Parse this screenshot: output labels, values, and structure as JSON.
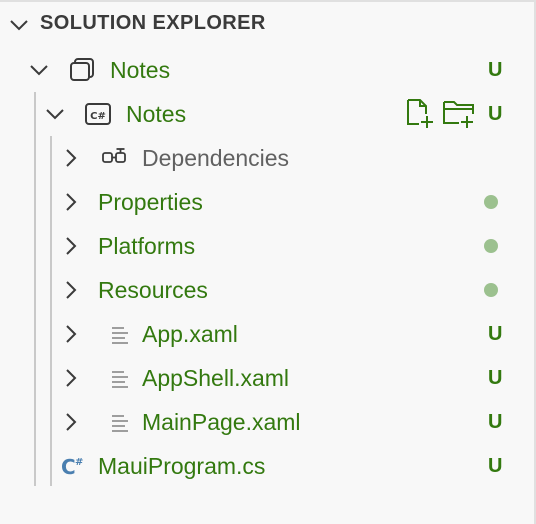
{
  "header": {
    "title": "SOLUTION EXPLORER"
  },
  "tree": {
    "solution": {
      "label": "Notes",
      "badge": "U",
      "icon": "solution-icon"
    },
    "project": {
      "label": "Notes",
      "badge": "U",
      "icon": "csharp-project-icon"
    },
    "items": [
      {
        "label": "Dependencies",
        "style": "gray",
        "icon": "dependencies-icon",
        "status": "",
        "expandable": true
      },
      {
        "label": "Properties",
        "style": "green",
        "icon": "",
        "status": "dot",
        "expandable": true
      },
      {
        "label": "Platforms",
        "style": "green",
        "icon": "",
        "status": "dot",
        "expandable": true
      },
      {
        "label": "Resources",
        "style": "green",
        "icon": "",
        "status": "dot",
        "expandable": true
      },
      {
        "label": "App.xaml",
        "style": "green",
        "icon": "file-lines-icon",
        "status": "U",
        "expandable": true
      },
      {
        "label": "AppShell.xaml",
        "style": "green",
        "icon": "file-lines-icon",
        "status": "U",
        "expandable": true
      },
      {
        "label": "MainPage.xaml",
        "style": "green",
        "icon": "file-lines-icon",
        "status": "U",
        "expandable": true
      },
      {
        "label": "MauiProgram.cs",
        "style": "green",
        "icon": "csharp-file-icon",
        "status": "U",
        "expandable": false
      }
    ]
  },
  "colors": {
    "modified_green": "#33790f",
    "dot_green": "#9cc18f",
    "text_gray": "#616161"
  }
}
